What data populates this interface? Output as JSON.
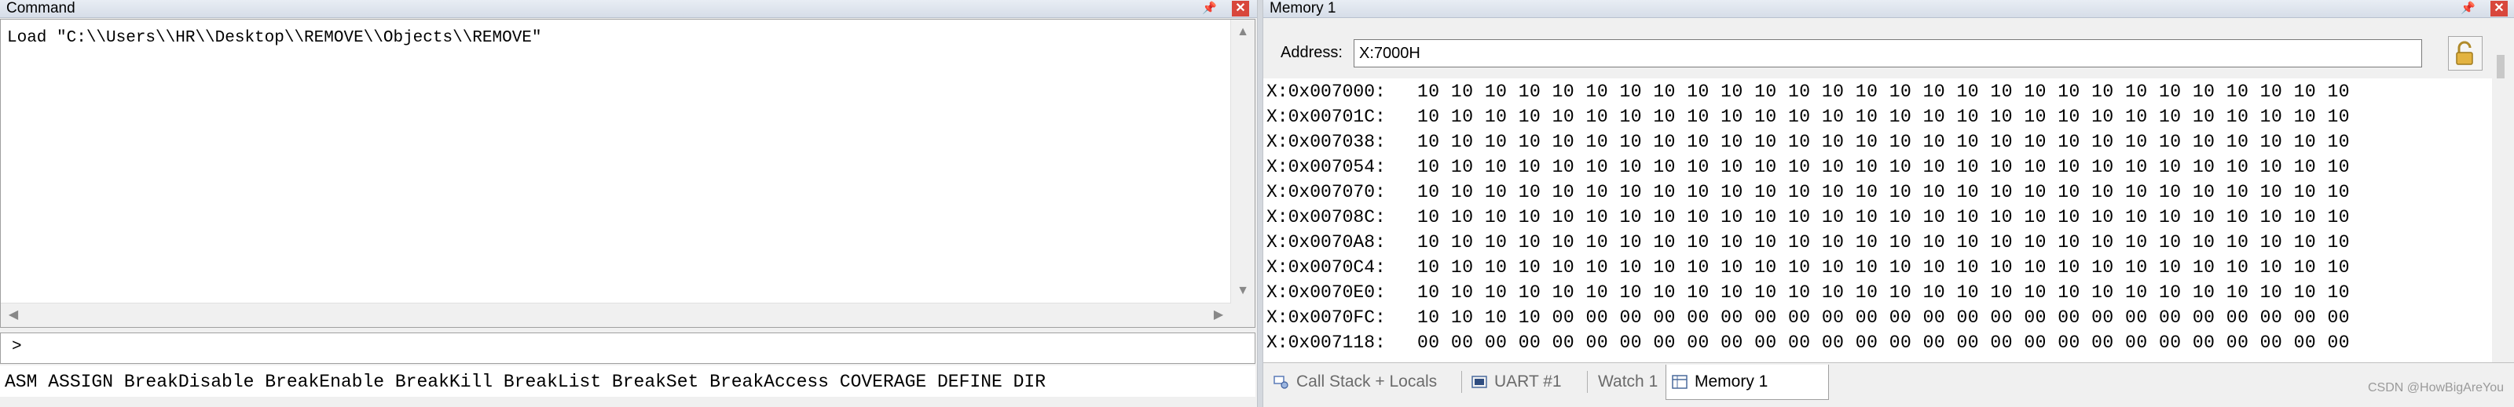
{
  "command": {
    "title": "Command",
    "output": "Load \"C:\\\\Users\\\\HR\\\\Desktop\\\\REMOVE\\\\Objects\\\\REMOVE\"",
    "prompt": ">",
    "help": "ASM ASSIGN BreakDisable BreakEnable BreakKill BreakList BreakSet BreakAccess COVERAGE DEFINE DIR"
  },
  "memory": {
    "title": "Memory 1",
    "address_label": "Address:",
    "address_value": "X:7000H",
    "rows": [
      {
        "addr": "X:0x007000:",
        "bytes": "10 10 10 10 10 10 10 10 10 10 10 10 10 10 10 10 10 10 10 10 10 10 10 10 10 10 10 10"
      },
      {
        "addr": "X:0x00701C:",
        "bytes": "10 10 10 10 10 10 10 10 10 10 10 10 10 10 10 10 10 10 10 10 10 10 10 10 10 10 10 10"
      },
      {
        "addr": "X:0x007038:",
        "bytes": "10 10 10 10 10 10 10 10 10 10 10 10 10 10 10 10 10 10 10 10 10 10 10 10 10 10 10 10"
      },
      {
        "addr": "X:0x007054:",
        "bytes": "10 10 10 10 10 10 10 10 10 10 10 10 10 10 10 10 10 10 10 10 10 10 10 10 10 10 10 10"
      },
      {
        "addr": "X:0x007070:",
        "bytes": "10 10 10 10 10 10 10 10 10 10 10 10 10 10 10 10 10 10 10 10 10 10 10 10 10 10 10 10"
      },
      {
        "addr": "X:0x00708C:",
        "bytes": "10 10 10 10 10 10 10 10 10 10 10 10 10 10 10 10 10 10 10 10 10 10 10 10 10 10 10 10"
      },
      {
        "addr": "X:0x0070A8:",
        "bytes": "10 10 10 10 10 10 10 10 10 10 10 10 10 10 10 10 10 10 10 10 10 10 10 10 10 10 10 10"
      },
      {
        "addr": "X:0x0070C4:",
        "bytes": "10 10 10 10 10 10 10 10 10 10 10 10 10 10 10 10 10 10 10 10 10 10 10 10 10 10 10 10"
      },
      {
        "addr": "X:0x0070E0:",
        "bytes": "10 10 10 10 10 10 10 10 10 10 10 10 10 10 10 10 10 10 10 10 10 10 10 10 10 10 10 10"
      },
      {
        "addr": "X:0x0070FC:",
        "bytes": "10 10 10 10 00 00 00 00 00 00 00 00 00 00 00 00 00 00 00 00 00 00 00 00 00 00 00 00"
      },
      {
        "addr": "X:0x007118:",
        "bytes": "00 00 00 00 00 00 00 00 00 00 00 00 00 00 00 00 00 00 00 00 00 00 00 00 00 00 00 00"
      }
    ],
    "tabs": [
      {
        "label": "Call Stack + Locals"
      },
      {
        "label": "UART #1"
      },
      {
        "label": "Watch 1"
      },
      {
        "label": "Memory 1"
      }
    ]
  },
  "watermark": "CSDN @HowBigAreYou",
  "colors": {
    "close": "#d8473c",
    "accent": "#d6dde8"
  }
}
